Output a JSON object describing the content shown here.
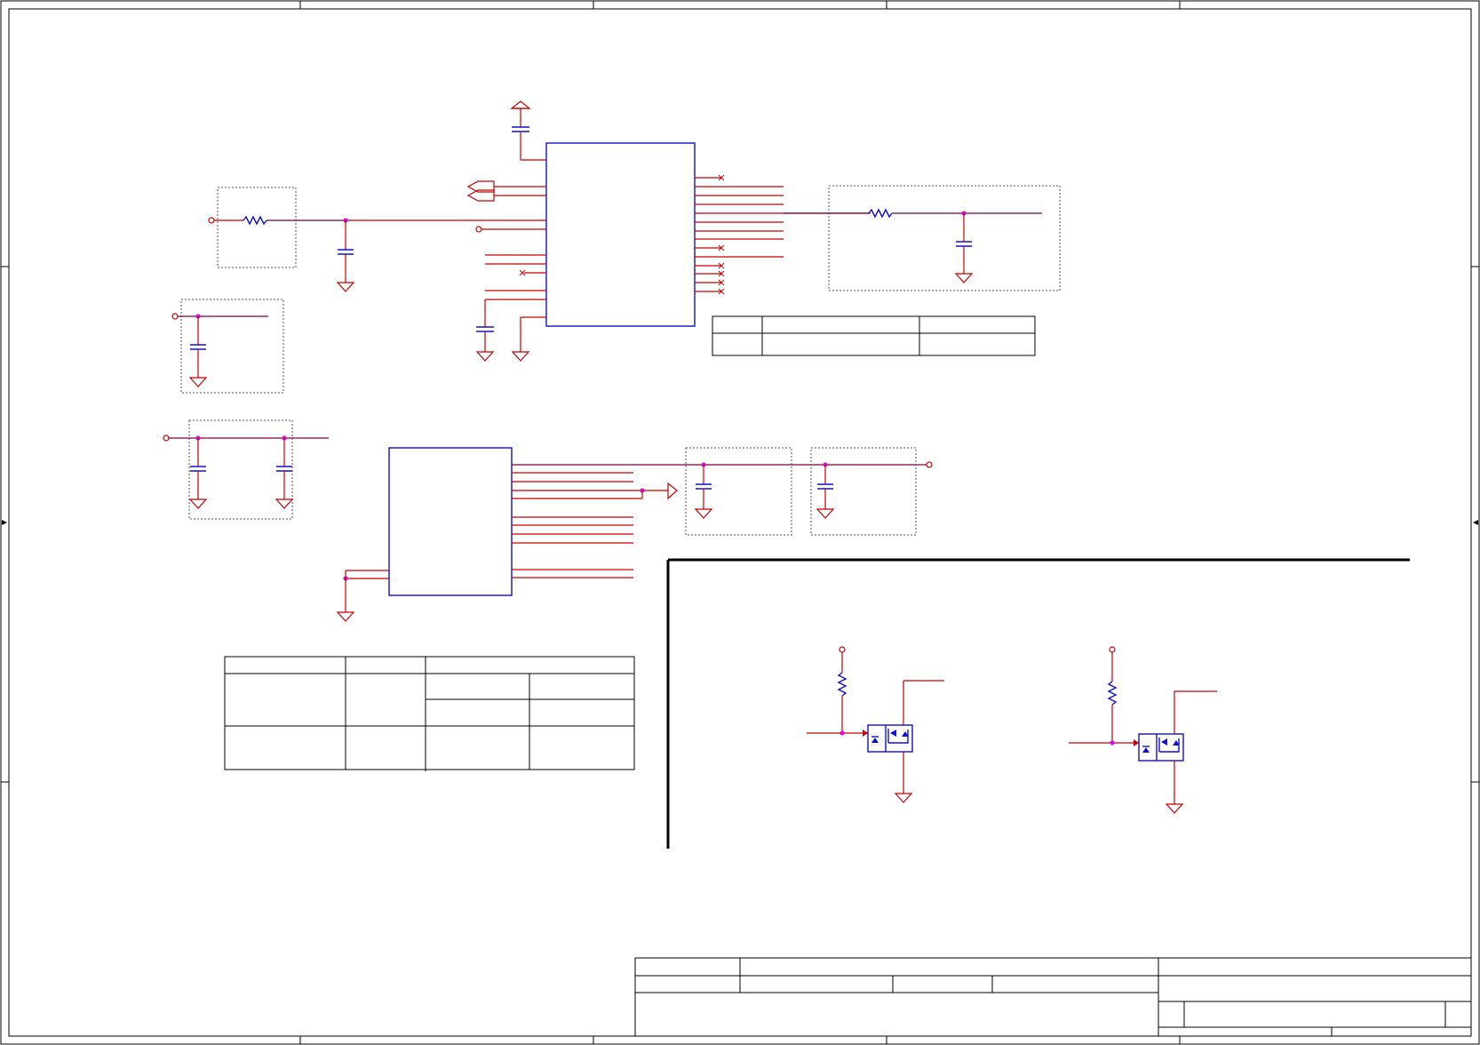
{
  "sheet": {
    "title": "",
    "colors": {
      "wire": "#c80000",
      "net": "#7a0040",
      "component": "#1010d0",
      "junction": "#e000e0",
      "frame": "#000000"
    }
  },
  "icons": {
    "ground": "ground-icon",
    "power": "power-arrow-icon",
    "capacitor": "capacitor-icon",
    "resistor": "resistor-icon",
    "mosfet": "mosfet-icon",
    "port": "port-circle-icon",
    "no_connect": "no-connect-x-icon"
  }
}
